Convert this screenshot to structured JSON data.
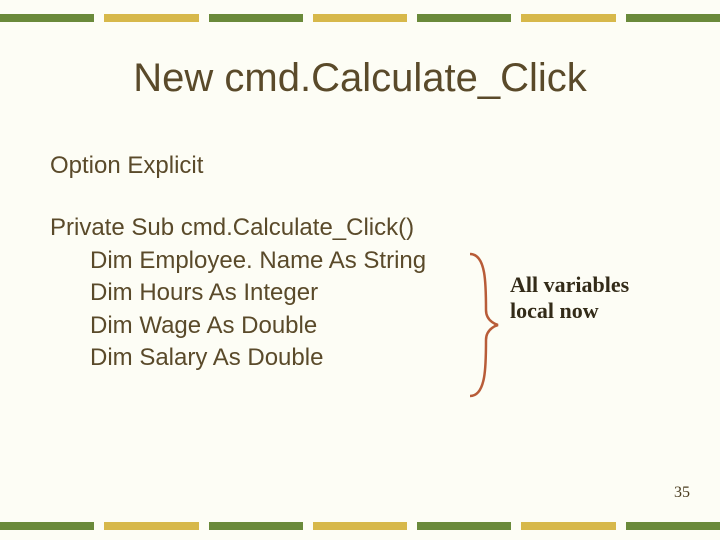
{
  "title": "New cmd.Calculate_Click",
  "code": {
    "option": "Option Explicit",
    "subline": "Private Sub cmd.Calculate_Click()",
    "dim1": "Dim Employee. Name As String",
    "dim2": "Dim Hours As Integer",
    "dim3": "Dim Wage As Double",
    "dim4": "Dim Salary As Double"
  },
  "annotation": {
    "line1": "All variables",
    "line2": "local now"
  },
  "page_number": "35",
  "colors": {
    "accent_green": "#6a8a3a",
    "accent_yellow": "#d7b84a",
    "brace": "#b85c38",
    "text": "#5a4a2a"
  }
}
